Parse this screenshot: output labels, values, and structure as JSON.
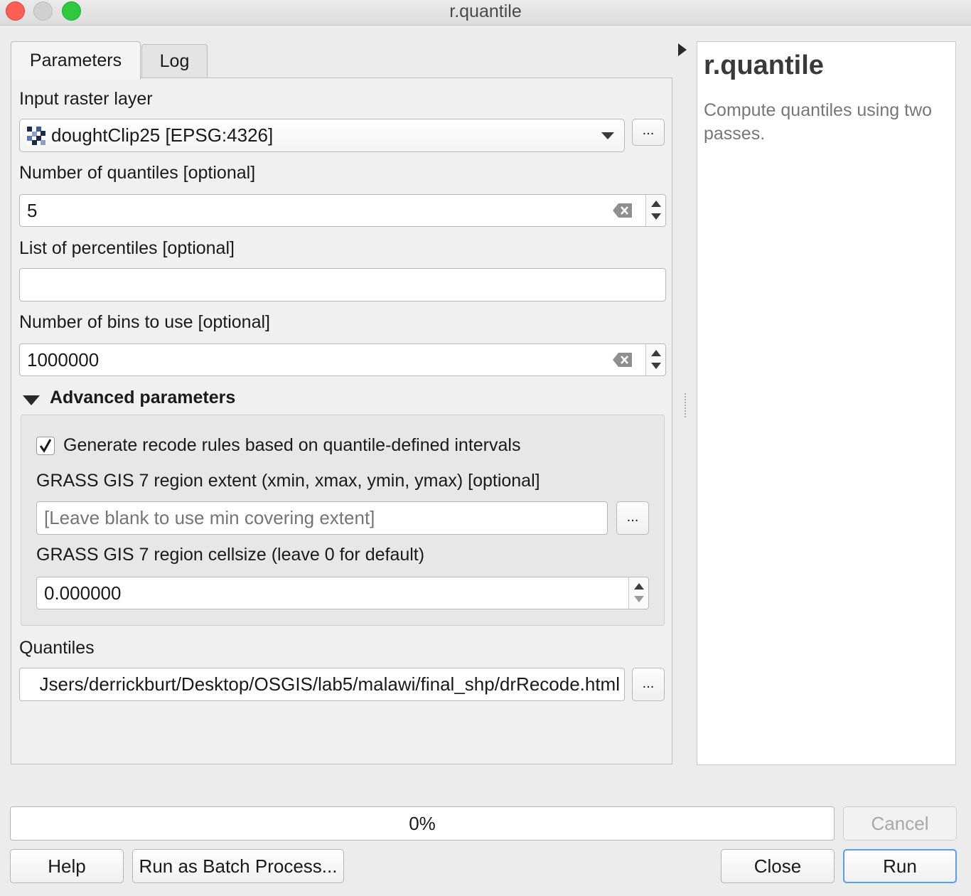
{
  "window": {
    "title": "r.quantile"
  },
  "tabs": [
    {
      "label": "Parameters",
      "active": true
    },
    {
      "label": "Log",
      "active": false
    }
  ],
  "params": {
    "input_raster_label": "Input raster layer",
    "input_raster_value": "doughtClip25 [EPSG:4326]",
    "quantiles_label": "Number of quantiles [optional]",
    "quantiles_value": "5",
    "percentiles_label": "List of percentiles [optional]",
    "percentiles_value": "",
    "bins_label": "Number of bins to use [optional]",
    "bins_value": "1000000",
    "browse_label": "..."
  },
  "advanced": {
    "title": "Advanced parameters",
    "expanded": true,
    "recode_label": "Generate recode rules based on quantile-defined intervals",
    "recode_checked": true,
    "extent_label": "GRASS GIS 7 region extent (xmin, xmax, ymin, ymax) [optional]",
    "extent_placeholder": "[Leave blank to use min covering extent]",
    "cellsize_label": "GRASS GIS 7 region cellsize (leave 0 for default)",
    "cellsize_value": "0.000000"
  },
  "output": {
    "quantiles_label": "Quantiles",
    "quantiles_value": "Jsers/derrickburt/Desktop/OSGIS/lab5/malawi/final_shp/drRecode.html"
  },
  "help": {
    "title": "r.quantile",
    "description": "Compute quantiles using two passes."
  },
  "progress": {
    "value": 0,
    "label": "0%"
  },
  "buttons": {
    "cancel": "Cancel",
    "help": "Help",
    "batch": "Run as Batch Process...",
    "close": "Close",
    "run": "Run"
  },
  "colors": {
    "accent": "#5c9de8",
    "close": "#fd5f57",
    "minimize": "#d0d0d0",
    "zoom": "#2ec93f"
  }
}
